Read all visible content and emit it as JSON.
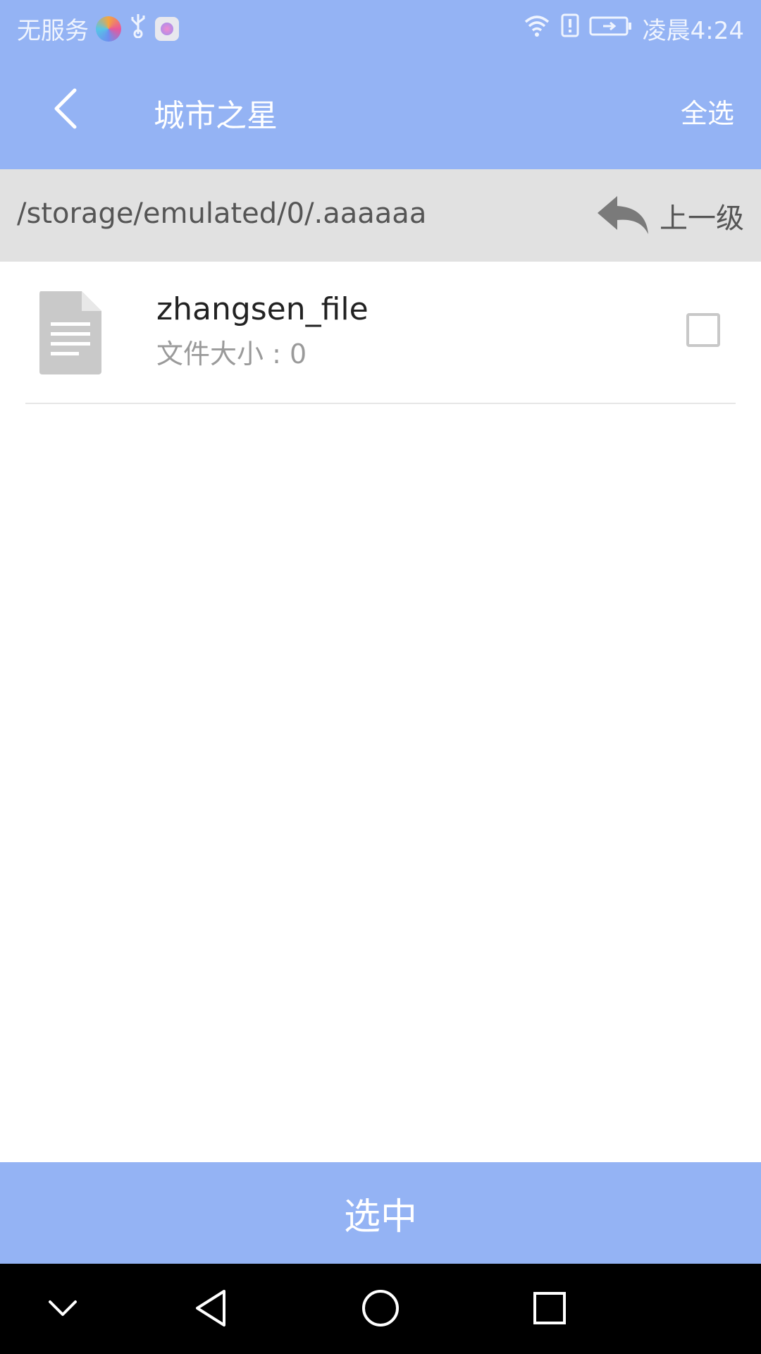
{
  "status_bar": {
    "carrier": "无服务",
    "time": "凌晨4:24",
    "icons": [
      "browser-icon",
      "usb-icon",
      "app-icon",
      "wifi-icon",
      "alert-icon",
      "battery-icon"
    ]
  },
  "app_bar": {
    "title": "城市之星",
    "select_all_label": "全选",
    "background_color": "#94b3f4"
  },
  "path_bar": {
    "path": "/storage/emulated/0/.aaaaaa",
    "up_level_label": "上一级"
  },
  "files": [
    {
      "name": "zhangsen_file",
      "size_label": "文件大小 : 0",
      "checked": false,
      "icon": "document-icon"
    }
  ],
  "action_button": {
    "label": "选中"
  },
  "nav_bar": {
    "keys": [
      "collapse-icon",
      "back-triangle-icon",
      "home-circle-icon",
      "recents-square-icon"
    ]
  }
}
